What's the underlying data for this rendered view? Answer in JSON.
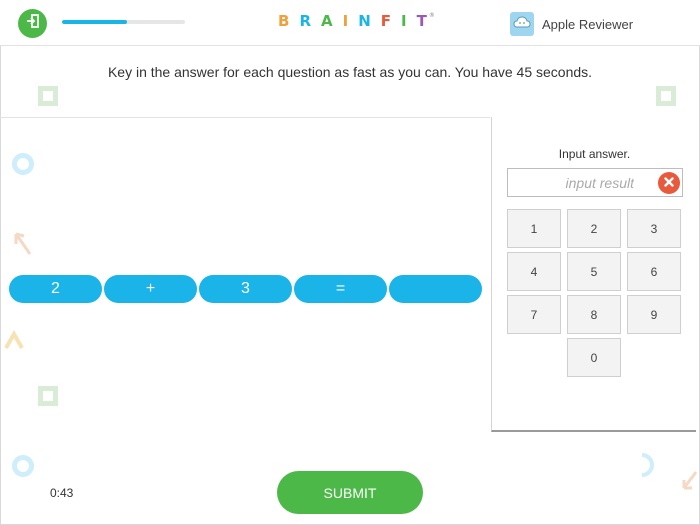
{
  "header": {
    "progress_fraction": 0.53,
    "logo": {
      "letters": [
        {
          "char": "B",
          "color": "#f1a13a"
        },
        {
          "char": "R",
          "color": "#1ab4e8"
        },
        {
          "char": "A",
          "color": "#4cb848"
        },
        {
          "char": "I",
          "color": "#f1a13a"
        },
        {
          "char": "N",
          "color": "#1ab4e8"
        },
        {
          "char": "F",
          "color": "#e9593c"
        },
        {
          "char": "I",
          "color": "#4cb848"
        },
        {
          "char": "T",
          "color": "#9b59b6"
        }
      ],
      "mark": "®"
    },
    "user_name": "Apple Reviewer"
  },
  "instruction": "Key in the answer for each question as fast as you can. You have 45 seconds.",
  "equation": [
    "2",
    "+",
    "3",
    "=",
    ""
  ],
  "keypad": {
    "title": "Input answer.",
    "answer_value": "",
    "answer_placeholder": "input result",
    "keys": [
      "1",
      "2",
      "3",
      "4",
      "5",
      "6",
      "7",
      "8",
      "9",
      "0"
    ]
  },
  "footer": {
    "timer": "0:43",
    "submit_label": "SUBMIT"
  },
  "colors": {
    "green": "#4cb848",
    "blue": "#1ab4e8",
    "red": "#e9593c"
  },
  "icons": {
    "exit": "exit-icon",
    "avatar": "cloud-icon",
    "clear": "close-icon"
  }
}
